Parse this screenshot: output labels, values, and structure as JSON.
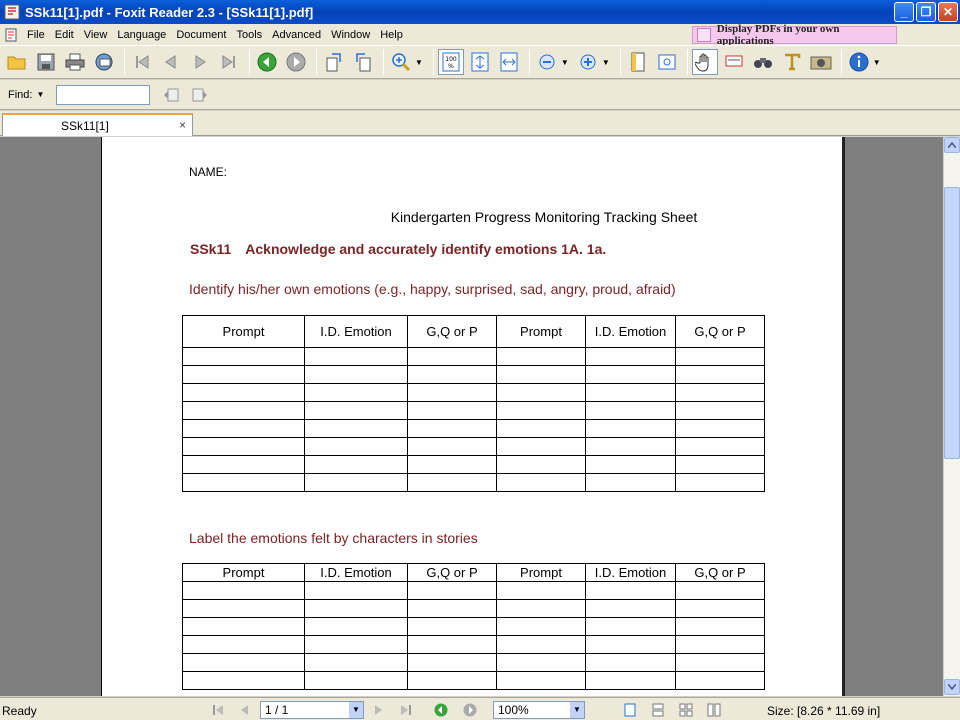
{
  "window": {
    "title": "SSk11[1].pdf - Foxit Reader 2.3 - [SSk11[1].pdf]",
    "buttons": [
      "_",
      "❐",
      "✕"
    ]
  },
  "menu": [
    "File",
    "Edit",
    "View",
    "Language",
    "Document",
    "Tools",
    "Advanced",
    "Window",
    "Help"
  ],
  "banner": "Display PDFs in your own applications",
  "find": {
    "label": "Find:",
    "value": ""
  },
  "tab": {
    "label": "SSk11[1]",
    "close": "×"
  },
  "document": {
    "name_label": "NAME:",
    "title": "Kindergarten Progress Monitoring Tracking Sheet",
    "standard_code": "SSk11",
    "standard_text": "Acknowledge and accurately identify emotions 1A. 1a.",
    "section1": "Identify his/her own emotions (e.g., happy, surprised, sad, angry, proud, afraid)",
    "section2": "Label the emotions felt by characters in stories",
    "columns": [
      "Prompt",
      "I.D. Emotion",
      "G,Q or P",
      "Prompt",
      "I.D. Emotion",
      "G,Q or P"
    ]
  },
  "status": {
    "ready": "Ready",
    "page": "1 / 1",
    "zoom": "100%",
    "size": "Size: [8.26 * 11.69 in]"
  },
  "icons": {
    "open": "folder-open-icon",
    "save": "save-icon",
    "print": "print-icon",
    "email": "email-icon",
    "first": "first-page-icon",
    "prev": "previous-page-icon",
    "next": "next-page-icon",
    "last": "last-page-icon",
    "back": "go-back-icon",
    "forward": "go-forward-icon"
  },
  "colors": {
    "accent_red": "#7b2424",
    "titlebar": "#0a5fd8",
    "tab_accent": "#f2a33a"
  }
}
